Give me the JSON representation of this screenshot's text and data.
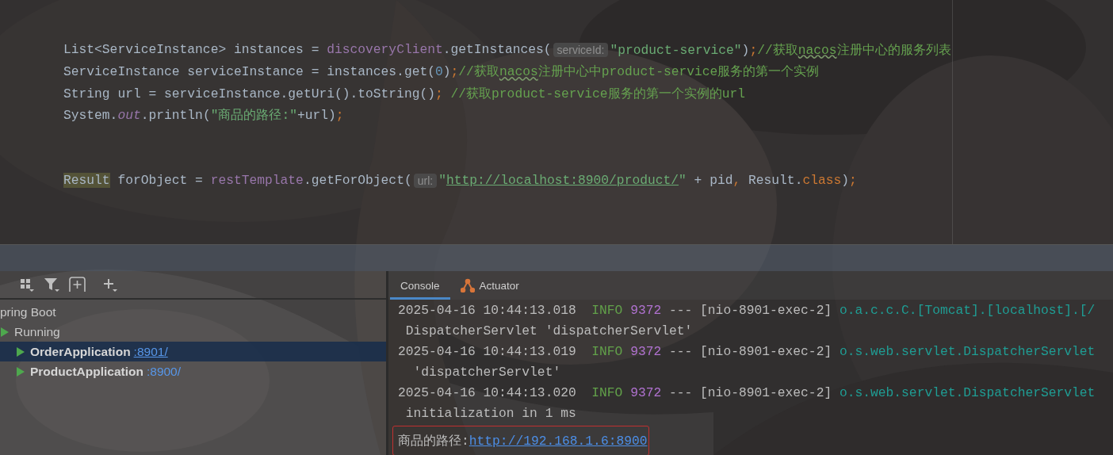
{
  "editor": {
    "blocks": [
      {
        "lines": [
          {
            "segments": [
              {
                "kind": "code",
                "tokens": [
                  {
                    "kind": "plain",
                    "text": "List<ServiceInstance> instances = "
                  },
                  {
                    "kind": "field",
                    "text": "discoveryClient"
                  },
                  {
                    "kind": "plain",
                    "text": ".getInstances("
                  }
                ]
              },
              {
                "kind": "hint",
                "text": "serviceId:"
              },
              {
                "kind": "code",
                "tokens": [
                  {
                    "kind": "string",
                    "text": "\"product-service\""
                  },
                  {
                    "kind": "plain",
                    "text": ")"
                  },
                  {
                    "kind": "punct",
                    "text": ";"
                  },
                  {
                    "kind": "comment",
                    "text": "//获取"
                  },
                  {
                    "kind": "typo",
                    "text": "nacos"
                  },
                  {
                    "kind": "comment",
                    "text": "注册中心的服务列表"
                  }
                ]
              }
            ]
          },
          {
            "segments": [
              {
                "kind": "code",
                "tokens": [
                  {
                    "kind": "plain",
                    "text": "ServiceInstance serviceInstance = instances.get("
                  },
                  {
                    "kind": "number",
                    "text": "0"
                  },
                  {
                    "kind": "plain",
                    "text": ")"
                  },
                  {
                    "kind": "punct",
                    "text": ";"
                  },
                  {
                    "kind": "comment",
                    "text": "//获取"
                  },
                  {
                    "kind": "typo",
                    "text": "nacos"
                  },
                  {
                    "kind": "comment",
                    "text": "注册中心中product-service服务的第一个实例"
                  }
                ]
              }
            ]
          },
          {
            "segments": [
              {
                "kind": "code",
                "tokens": [
                  {
                    "kind": "plain",
                    "text": "String url = serviceInstance.getUri().toString()"
                  },
                  {
                    "kind": "punct",
                    "text": ";"
                  },
                  {
                    "kind": "comment",
                    "text": " //获取product-service服务的第一个实例的url"
                  }
                ]
              }
            ]
          },
          {
            "segments": [
              {
                "kind": "code",
                "tokens": [
                  {
                    "kind": "plain",
                    "text": "System."
                  },
                  {
                    "kind": "static",
                    "text": "out"
                  },
                  {
                    "kind": "plain",
                    "text": ".println("
                  },
                  {
                    "kind": "string",
                    "text": "\"商品的路径:\""
                  },
                  {
                    "kind": "plain",
                    "text": "+url)"
                  },
                  {
                    "kind": "punct",
                    "text": ";"
                  }
                ]
              }
            ]
          }
        ]
      },
      {
        "lines": [
          {
            "segments": [
              {
                "kind": "code",
                "tokens": [
                  {
                    "kind": "highlight",
                    "text": "Result"
                  },
                  {
                    "kind": "plain",
                    "text": " forObject = "
                  },
                  {
                    "kind": "field",
                    "text": "restTemplate"
                  },
                  {
                    "kind": "plain",
                    "text": ".getForObject("
                  }
                ]
              },
              {
                "kind": "hint",
                "text": "url:"
              },
              {
                "kind": "code",
                "tokens": [
                  {
                    "kind": "string",
                    "text": "\""
                  },
                  {
                    "kind": "url",
                    "text": "http://localhost:8900/product/"
                  },
                  {
                    "kind": "string",
                    "text": "\""
                  },
                  {
                    "kind": "plain",
                    "text": " + pid"
                  },
                  {
                    "kind": "punct",
                    "text": ","
                  },
                  {
                    "kind": "plain",
                    "text": " Result."
                  },
                  {
                    "kind": "keyword",
                    "text": "class"
                  },
                  {
                    "kind": "plain",
                    "text": ")"
                  },
                  {
                    "kind": "punct",
                    "text": ";"
                  }
                ]
              }
            ]
          }
        ]
      }
    ]
  },
  "services": {
    "tree": [
      {
        "kind": "group",
        "label": "pring Boot",
        "selected": false,
        "children": [
          {
            "kind": "status",
            "label": "Running",
            "selected": false,
            "children": [
              {
                "kind": "app",
                "label": "OrderApplication",
                "port": ":8901/",
                "selected": true
              },
              {
                "kind": "app",
                "label": "ProductApplication",
                "port": ":8900/",
                "selected": false
              }
            ]
          }
        ]
      }
    ]
  },
  "console": {
    "tabs": [
      {
        "label": "Console",
        "selected": true
      },
      {
        "label": "Actuator",
        "selected": false
      }
    ],
    "lines": [
      {
        "boxed": false,
        "tokens": [
          {
            "kind": "plain",
            "text": "2025-04-16 10:44:13.018  "
          },
          {
            "kind": "info",
            "text": "INFO "
          },
          {
            "kind": "pid",
            "text": "9372"
          },
          {
            "kind": "plain",
            "text": " --- [nio-8901-exec-2] "
          },
          {
            "kind": "logger",
            "text": "o.a.c.c.C.[Tomcat].[localhost].[/"
          }
        ]
      },
      {
        "boxed": false,
        "tokens": [
          {
            "kind": "plain",
            "text": " DispatcherServlet 'dispatcherServlet'"
          }
        ]
      },
      {
        "boxed": false,
        "tokens": [
          {
            "kind": "plain",
            "text": "2025-04-16 10:44:13.019  "
          },
          {
            "kind": "info",
            "text": "INFO "
          },
          {
            "kind": "pid",
            "text": "9372"
          },
          {
            "kind": "plain",
            "text": " --- [nio-8901-exec-2] "
          },
          {
            "kind": "logger",
            "text": "o.s.web.servlet.DispatcherServlet"
          }
        ]
      },
      {
        "boxed": false,
        "tokens": [
          {
            "kind": "plain",
            "text": "  'dispatcherServlet'"
          }
        ]
      },
      {
        "boxed": false,
        "tokens": [
          {
            "kind": "plain",
            "text": "2025-04-16 10:44:13.020  "
          },
          {
            "kind": "info",
            "text": "INFO "
          },
          {
            "kind": "pid",
            "text": "9372"
          },
          {
            "kind": "plain",
            "text": " --- [nio-8901-exec-2] "
          },
          {
            "kind": "logger",
            "text": "o.s.web.servlet.DispatcherServlet"
          }
        ]
      },
      {
        "boxed": false,
        "tokens": [
          {
            "kind": "plain",
            "text": " initialization in 1 ms"
          }
        ]
      },
      {
        "boxed": true,
        "tokens": [
          {
            "kind": "plain",
            "text": "商品的路径:"
          },
          {
            "kind": "link",
            "text": "http://192.168.1.6:8900"
          }
        ]
      }
    ]
  }
}
